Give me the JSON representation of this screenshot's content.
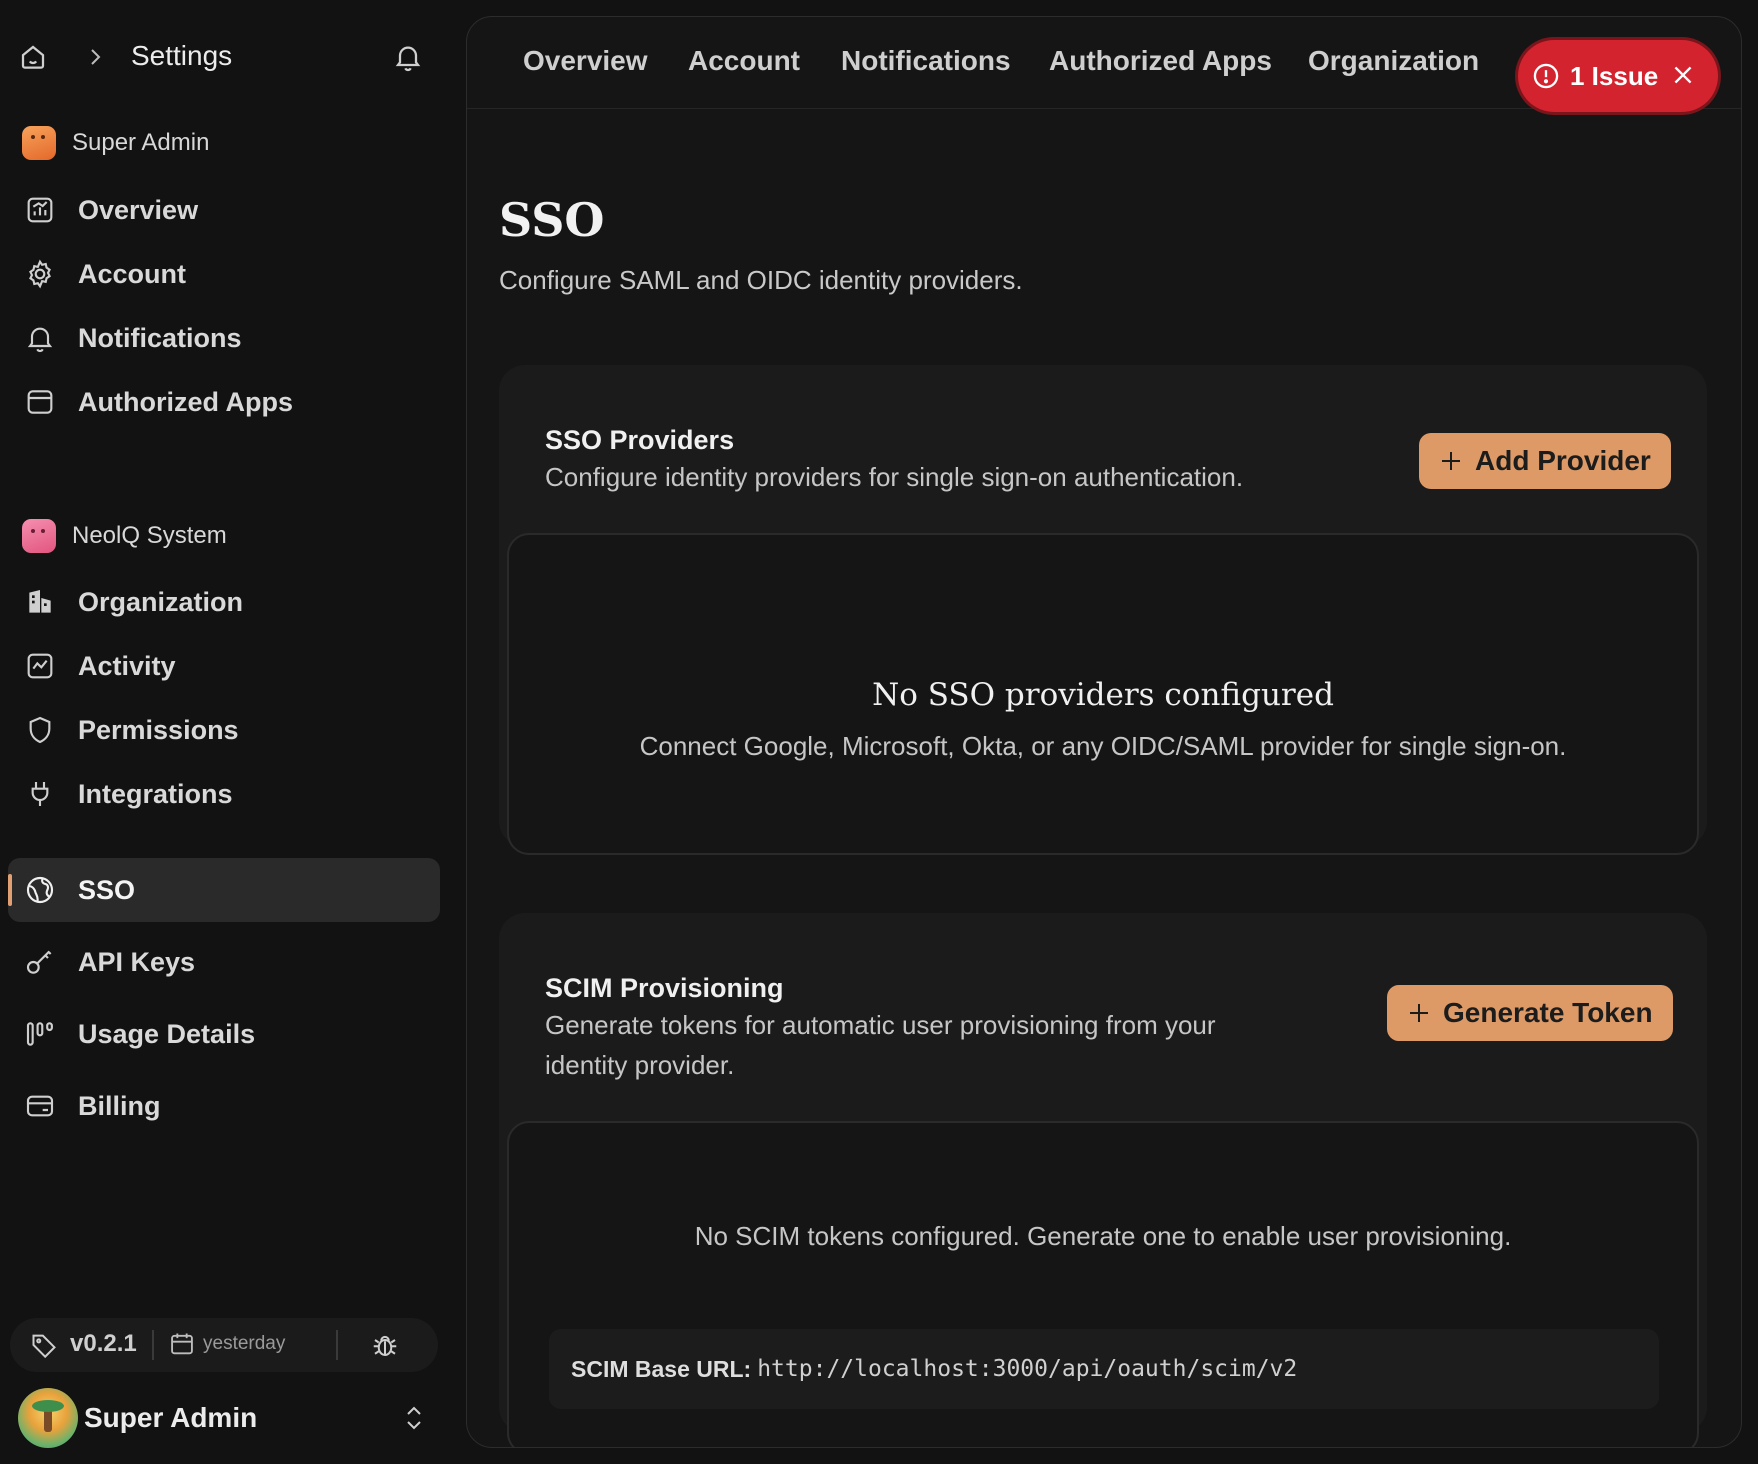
{
  "sidebar": {
    "header_title": "Settings",
    "group1_label": "Super Admin",
    "group2_label": "NeolQ System",
    "items": [
      {
        "label": "Overview",
        "icon": "chart-icon"
      },
      {
        "label": "Account",
        "icon": "gear-icon"
      },
      {
        "label": "Notifications",
        "icon": "bell-icon"
      },
      {
        "label": "Authorized Apps",
        "icon": "app-window-icon"
      },
      {
        "label": "Organization",
        "icon": "building-icon"
      },
      {
        "label": "Activity",
        "icon": "activity-icon"
      },
      {
        "label": "Permissions",
        "icon": "shield-icon"
      },
      {
        "label": "Integrations",
        "icon": "plug-icon"
      },
      {
        "label": "SSO",
        "icon": "globe-icon",
        "active": true
      },
      {
        "label": "API Keys",
        "icon": "key-icon"
      },
      {
        "label": "Usage Details",
        "icon": "usage-icon"
      },
      {
        "label": "Billing",
        "icon": "card-icon"
      }
    ],
    "footer": {
      "version": "v0.2.1",
      "date": "yesterday"
    },
    "user_name": "Super Admin"
  },
  "topnav": {
    "tabs": [
      "Overview",
      "Account",
      "Notifications",
      "Authorized Apps",
      "Organization"
    ],
    "issue_label": "1 Issue"
  },
  "page": {
    "title": "SSO",
    "subtitle": "Configure SAML and OIDC identity providers."
  },
  "sso_card": {
    "title": "SSO Providers",
    "description": "Configure identity providers for single sign-on authentication.",
    "button_label": "Add Provider",
    "empty_title": "No SSO providers configured",
    "empty_desc": "Connect Google, Microsoft, Okta, or any OIDC/SAML provider for single sign-on."
  },
  "scim_card": {
    "title": "SCIM Provisioning",
    "description_line1": "Generate tokens for automatic user provisioning from your",
    "description_line2": "identity provider.",
    "button_label": "Generate Token",
    "empty_desc": "No SCIM tokens configured. Generate one to enable user provisioning.",
    "base_url_label": "SCIM Base URL:",
    "base_url": "http://localhost:3000/api/oauth/scim/v2"
  },
  "colors": {
    "accent": "#dd9a67",
    "issue_red": "#d2232f",
    "background": "#121212"
  }
}
